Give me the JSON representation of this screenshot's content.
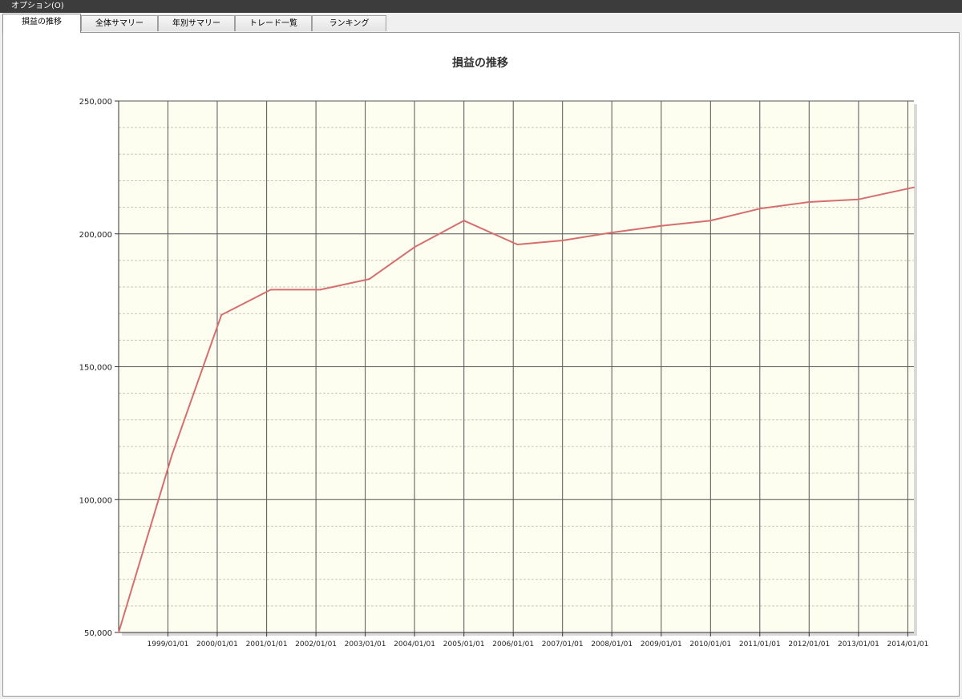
{
  "menubar": {
    "options_label": "オプション(O)"
  },
  "tabs": [
    {
      "label": "損益の推移",
      "active": true
    },
    {
      "label": "全体サマリー",
      "active": false
    },
    {
      "label": "年別サマリー",
      "active": false
    },
    {
      "label": "トレード一覧",
      "active": false
    },
    {
      "label": "ランキング",
      "active": false
    }
  ],
  "colors": {
    "plot_background": "#fdfdf0",
    "line": "#d56f6f",
    "grid_major": "#555555",
    "grid_minor": "#c8c8b8"
  },
  "chart_data": {
    "type": "line",
    "title": "損益の推移",
    "xlabel": "",
    "ylabel": "",
    "ylim": [
      50000,
      250000
    ],
    "yticks": [
      50000,
      100000,
      150000,
      200000,
      250000
    ],
    "ytick_labels": [
      "50,000",
      "100,000",
      "150,000",
      "200,000",
      "250,000"
    ],
    "x_range": [
      "1998/01/01",
      "2014/02/15"
    ],
    "xtick_labels": [
      "1999/01/01",
      "2000/01/01",
      "2001/01/01",
      "2002/01/01",
      "2003/01/01",
      "2004/01/01",
      "2005/01/01",
      "2006/01/01",
      "2007/01/01",
      "2008/01/01",
      "2009/01/01",
      "2010/01/01",
      "2011/01/01",
      "2012/01/01",
      "2013/01/01",
      "2014/01/01"
    ],
    "grid": true,
    "legend": "none",
    "series": [
      {
        "x": [
          "1998/01/01",
          "1999/02/01",
          "2000/02/01",
          "2001/02/01",
          "2002/02/01",
          "2003/02/01",
          "2004/01/01",
          "2005/01/01",
          "2006/02/01",
          "2007/01/01",
          "2008/01/01",
          "2009/01/01",
          "2010/01/01",
          "2011/01/01",
          "2012/01/01",
          "2013/01/01",
          "2014/02/15"
        ],
        "values": [
          50000,
          117000,
          169500,
          179000,
          179000,
          183000,
          195000,
          205000,
          196000,
          197500,
          200500,
          203000,
          205000,
          209500,
          212000,
          213000,
          217500
        ]
      }
    ]
  }
}
